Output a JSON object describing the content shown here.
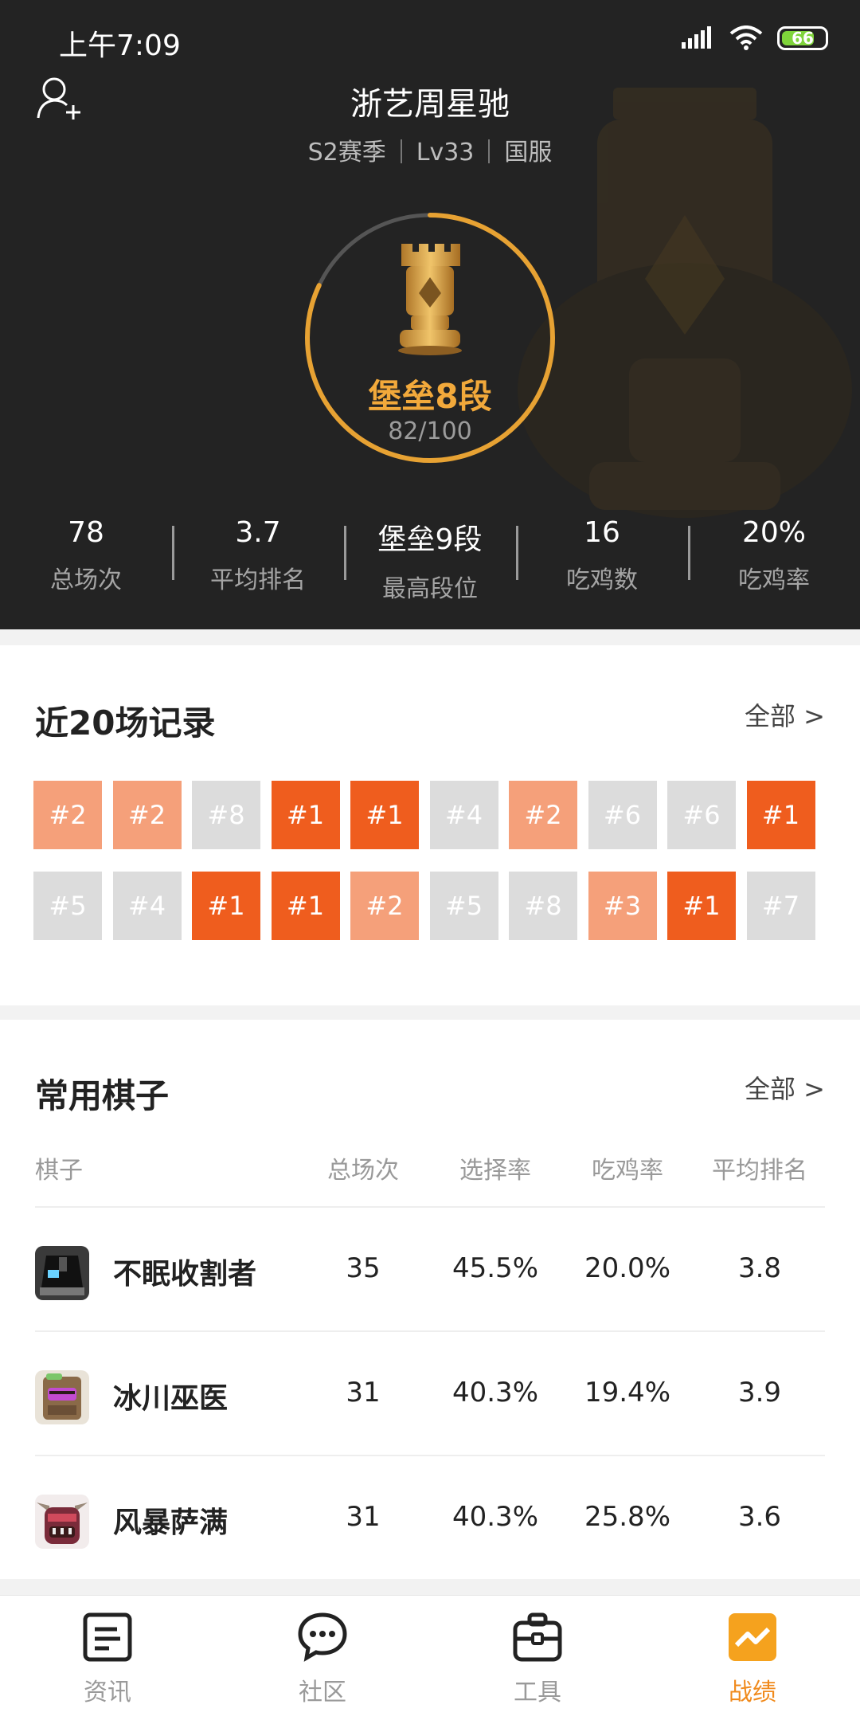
{
  "status_bar": {
    "time": "上午7:09",
    "battery": "66"
  },
  "profile": {
    "name": "浙艺周星驰",
    "season": "S2赛季",
    "level": "Lv33",
    "server": "国服",
    "rank_name": "堡垒8段",
    "rank_progress": "82/100",
    "rank_progress_fraction": 0.82
  },
  "stats": [
    {
      "value": "78",
      "label": "总场次"
    },
    {
      "value": "3.7",
      "label": "平均排名"
    },
    {
      "value": "堡垒9段",
      "label": "最高段位"
    },
    {
      "value": "16",
      "label": "吃鸡数"
    },
    {
      "value": "20%",
      "label": "吃鸡率"
    }
  ],
  "recent": {
    "title": "近20场记录",
    "more": "全部 >",
    "results": [
      "#2",
      "#2",
      "#8",
      "#1",
      "#1",
      "#4",
      "#2",
      "#6",
      "#6",
      "#1",
      "#5",
      "#4",
      "#1",
      "#1",
      "#2",
      "#5",
      "#8",
      "#3",
      "#1",
      "#7"
    ]
  },
  "pieces": {
    "title": "常用棋子",
    "more": "全部 >",
    "headers": [
      "棋子",
      "总场次",
      "选择率",
      "吃鸡率",
      "平均排名"
    ],
    "rows": [
      {
        "name": "不眠收割者",
        "games": "35",
        "pick": "45.5%",
        "win": "20.0%",
        "avg": "3.8",
        "icon": "sleepless-reaper-avatar"
      },
      {
        "name": "冰川巫医",
        "games": "31",
        "pick": "40.3%",
        "win": "19.4%",
        "avg": "3.9",
        "icon": "glacier-witch-doctor-avatar"
      },
      {
        "name": "风暴萨满",
        "games": "31",
        "pick": "40.3%",
        "win": "25.8%",
        "avg": "3.6",
        "icon": "storm-shaman-avatar"
      }
    ]
  },
  "tabs": [
    {
      "label": "资讯",
      "icon": "news-icon"
    },
    {
      "label": "社区",
      "icon": "chat-bubble-icon"
    },
    {
      "label": "工具",
      "icon": "toolbox-icon"
    },
    {
      "label": "战绩",
      "icon": "chart-icon",
      "active": true
    }
  ],
  "colors": {
    "accent": "#f08a1c",
    "first_place": "#ef5d1e",
    "top_place": "#f5a07a",
    "other_place": "#dcdcdc",
    "rank_gold": "#f2a93b"
  }
}
